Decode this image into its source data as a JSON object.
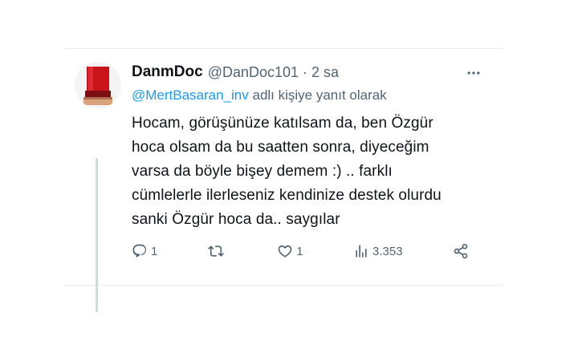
{
  "tweet": {
    "display_name": "DanmDoc",
    "handle": "@DanDoc101",
    "separator": "·",
    "time": "2 sa",
    "reply_mention": "@MertBasaran_inv",
    "reply_suffix": " adlı kişiye yanıt olarak",
    "text": "Hocam, görüşünüze katılsam da, ben Özgür\nhoca olsam da bu saatten sonra, diyeceğim\nvarsa da böyle bişey demem :) .. farklı\ncümlelerle ilerleseniz kendinize destek olurdu\nsanki Özgür hoca da.. saygılar"
  },
  "actions": {
    "reply_count": "1",
    "retweet_count": "",
    "like_count": "1",
    "views_count": "3.353"
  },
  "icons": {
    "more": "more-horizontal-icon",
    "reply": "reply-bubble-icon",
    "retweet": "retweet-icon",
    "like": "heart-icon",
    "views": "views-bar-chart-icon",
    "share": "share-icon"
  },
  "colors": {
    "text": "#0f1419",
    "secondary": "#536471",
    "link": "#1d9bf0",
    "thread_line": "#cfd9de"
  }
}
